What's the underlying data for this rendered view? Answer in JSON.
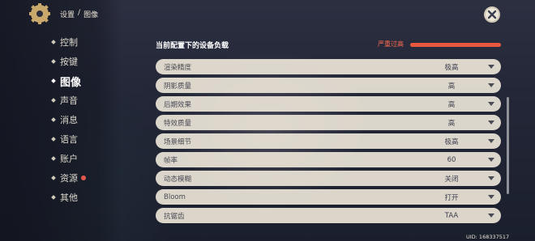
{
  "header": {
    "section": "设置",
    "separator": "/",
    "page": "图像"
  },
  "nav": {
    "items": [
      {
        "label": "控制",
        "active": false
      },
      {
        "label": "按键",
        "active": false
      },
      {
        "label": "图像",
        "active": true
      },
      {
        "label": "声音",
        "active": false
      },
      {
        "label": "消息",
        "active": false
      },
      {
        "label": "语言",
        "active": false
      },
      {
        "label": "账户",
        "active": false
      },
      {
        "label": "资源",
        "active": false,
        "badge": true
      },
      {
        "label": "其他",
        "active": false
      }
    ]
  },
  "device_load": {
    "title": "当前配置下的设备负载",
    "status": "严重过高",
    "level_fraction": 1.0,
    "status_color": "#ff6b50"
  },
  "settings": [
    {
      "label": "渲染精度",
      "value": "极高"
    },
    {
      "label": "阴影质量",
      "value": "高"
    },
    {
      "label": "后期效果",
      "value": "高"
    },
    {
      "label": "特效质量",
      "value": "高"
    },
    {
      "label": "场景细节",
      "value": "极高"
    },
    {
      "label": "帧率",
      "value": "60"
    },
    {
      "label": "动态模糊",
      "value": "关闭"
    },
    {
      "label": "Bloom",
      "value": "打开"
    },
    {
      "label": "抗锯齿",
      "value": "TAA"
    }
  ],
  "footer": {
    "uid": "UID: 168337517"
  },
  "icons": {
    "settings": "gear-icon",
    "close": "close-icon",
    "dropdown": "chevron-down-icon"
  }
}
